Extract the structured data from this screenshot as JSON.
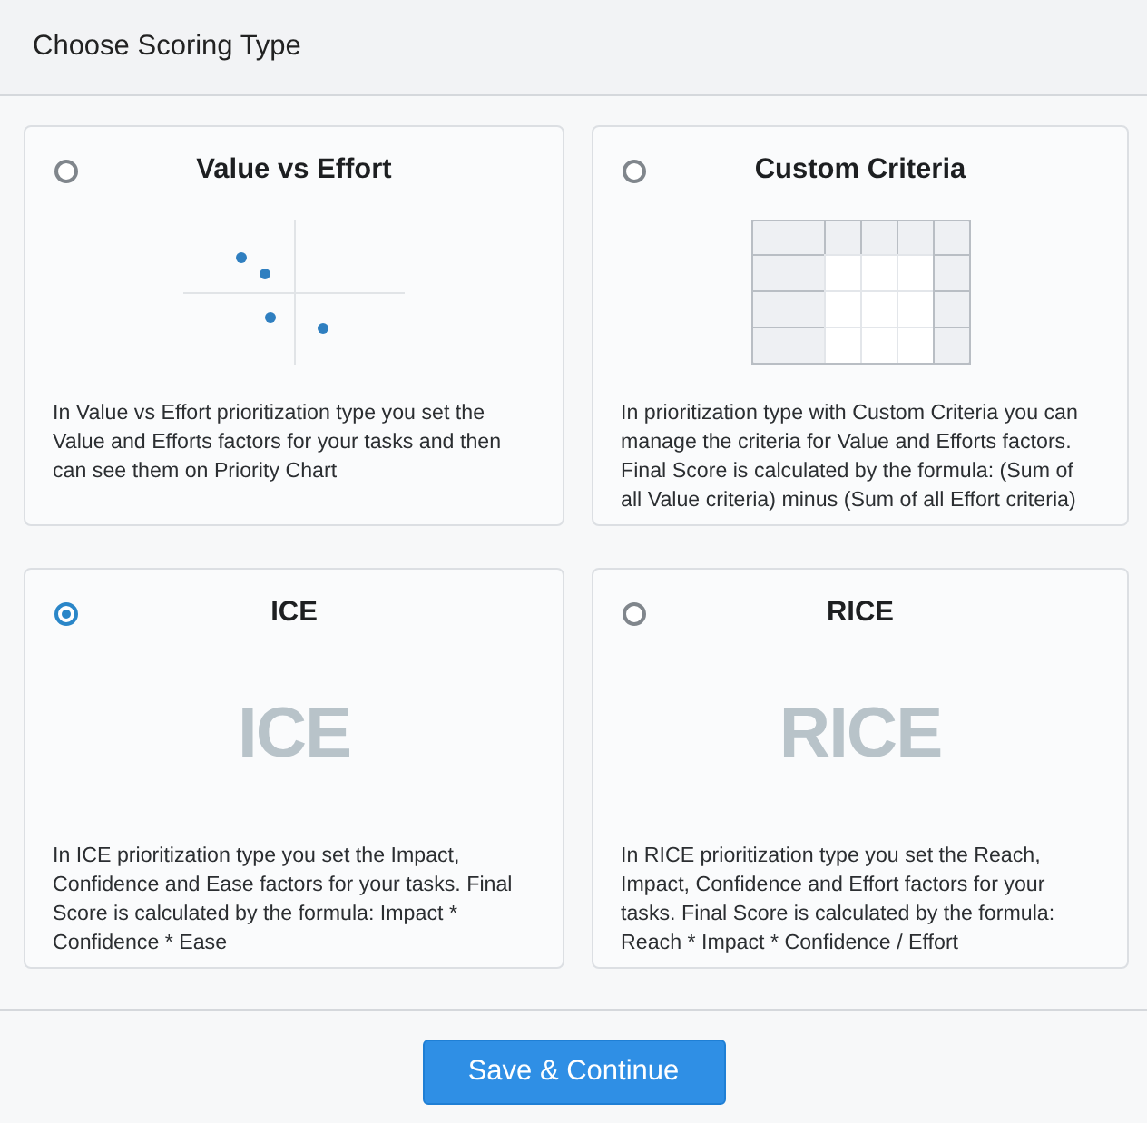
{
  "header": {
    "title": "Choose Scoring Type"
  },
  "options": [
    {
      "title": "Value vs Effort",
      "selected": false,
      "illustration": {
        "kind": "scatter"
      },
      "description": "In Value vs Effort prioritization type you set the Value and Efforts factors for your tasks and then can see them on Priority Chart"
    },
    {
      "title": "Custom Criteria",
      "selected": false,
      "illustration": {
        "kind": "grid"
      },
      "description": "In prioritization type with Custom Criteria you can manage the criteria for Value and Efforts factors. Final Score is calculated by the formula: (Sum of all Value criteria) minus (Sum of all Effort criteria)"
    },
    {
      "title": "ICE",
      "selected": true,
      "illustration": {
        "kind": "wordmark",
        "text": "ICE"
      },
      "description": "In ICE prioritization type you set the Impact, Confidence and Ease factors for your tasks. Final Score is calculated by the formula: Impact * Confidence * Ease"
    },
    {
      "title": "RICE",
      "selected": false,
      "illustration": {
        "kind": "wordmark",
        "text": "RICE"
      },
      "description": "In RICE prioritization type you set the Reach, Impact, Confidence and Effort factors for your tasks. Final Score is calculated by the formula: Reach * Impact * Confidence / Effort"
    }
  ],
  "footer": {
    "button": "Save & Continue"
  }
}
